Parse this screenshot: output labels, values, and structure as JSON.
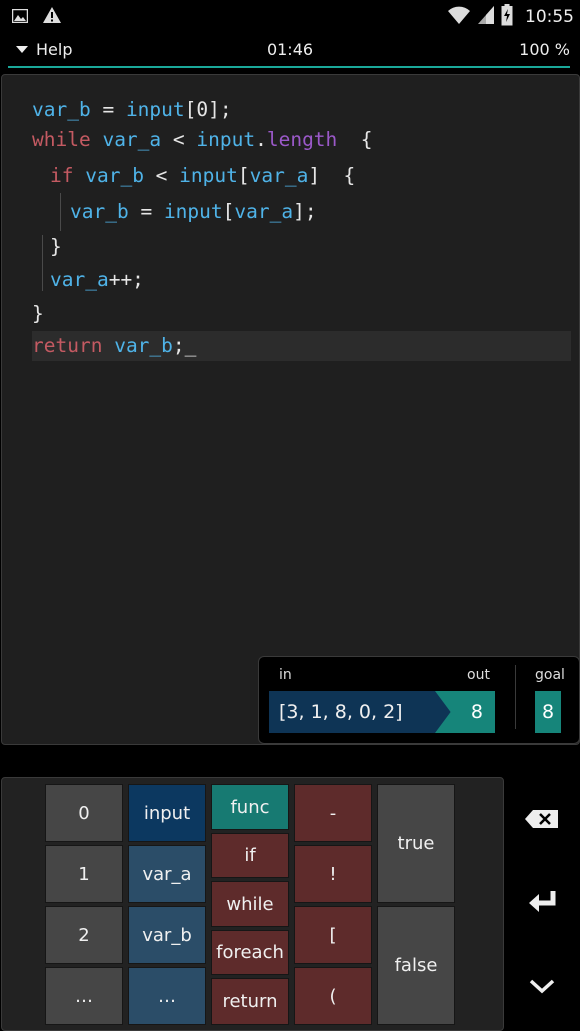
{
  "status_bar": {
    "time": "10:55",
    "icons_left": [
      "image-icon",
      "warning-icon"
    ],
    "icons_right": [
      "wifi-icon",
      "signal-icon",
      "battery-icon"
    ]
  },
  "top_bar": {
    "help_label": "Help",
    "timer": "01:46",
    "percent": "100 %"
  },
  "code_lines": [
    {
      "indent": 0,
      "tokens": [
        [
          "v",
          "var_b"
        ],
        [
          "p",
          " = "
        ],
        [
          "v",
          "input"
        ],
        [
          "p",
          "[0];"
        ]
      ]
    },
    {
      "indent": 0,
      "tokens": [
        [
          "k",
          "while"
        ],
        [
          "p",
          " "
        ],
        [
          "v",
          "var_a"
        ],
        [
          "p",
          " < "
        ],
        [
          "v",
          "input"
        ],
        [
          "p",
          "."
        ],
        [
          "m",
          "length"
        ],
        [
          "p",
          "  {"
        ]
      ]
    },
    {
      "indent": 1,
      "tokens": [
        [
          "k",
          "if"
        ],
        [
          "p",
          " "
        ],
        [
          "v",
          "var_b"
        ],
        [
          "p",
          " < "
        ],
        [
          "v",
          "input"
        ],
        [
          "p",
          "["
        ],
        [
          "v",
          "var_a"
        ],
        [
          "p",
          "]  {"
        ]
      ]
    },
    {
      "indent": 2,
      "tokens": [
        [
          "v",
          "var_b"
        ],
        [
          "p",
          " = "
        ],
        [
          "v",
          "input"
        ],
        [
          "p",
          "["
        ],
        [
          "v",
          "var_a"
        ],
        [
          "p",
          "];"
        ]
      ]
    },
    {
      "indent": 1,
      "tokens": [
        [
          "p",
          "}"
        ]
      ]
    },
    {
      "indent": 1,
      "tokens": [
        [
          "v",
          "var_a"
        ],
        [
          "p",
          "++;"
        ]
      ]
    },
    {
      "indent": 0,
      "tokens": [
        [
          "p",
          "}"
        ]
      ]
    },
    {
      "indent": 0,
      "tokens": [
        [
          "k",
          "return"
        ],
        [
          "p",
          " "
        ],
        [
          "v",
          "var_b"
        ],
        [
          "p",
          ";_"
        ]
      ]
    }
  ],
  "io": {
    "in_label": "in",
    "out_label": "out",
    "goal_label": "goal",
    "input_value": "[3, 1, 8, 0, 2]",
    "output_value": "8",
    "goal_value": "8"
  },
  "keyboard": {
    "numbers": [
      "0",
      "1",
      "2",
      "…"
    ],
    "variables": [
      "input",
      "var_a",
      "var_b",
      "…"
    ],
    "keywords": [
      "func",
      "if",
      "while",
      "foreach",
      "return"
    ],
    "symbols": [
      "-",
      "!",
      "[",
      "("
    ],
    "booleans": [
      "true",
      "false"
    ]
  },
  "side_buttons": [
    "backspace-icon",
    "enter-icon",
    "collapse-icon"
  ],
  "colors": {
    "accent_teal": "#1aa89a",
    "variable": "#4fb3e8",
    "keyword": "#c45a62",
    "member": "#9b59c9",
    "input_box": "#0e3455"
  }
}
